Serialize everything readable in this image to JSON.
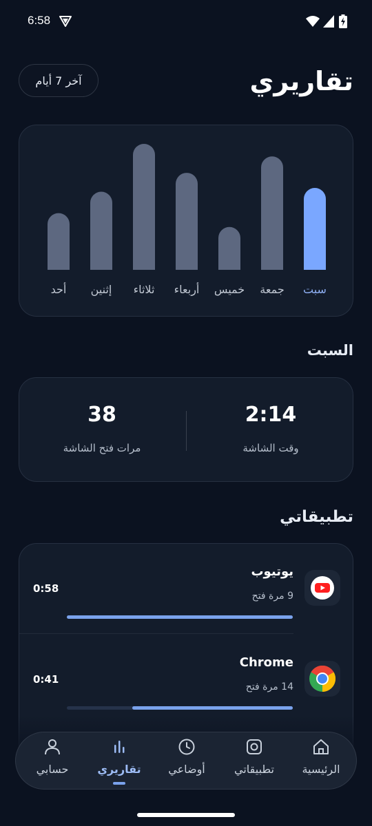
{
  "status_bar": {
    "time": "6:58"
  },
  "header": {
    "title": "تقاريري",
    "range_chip": "آخر 7 أيام"
  },
  "chart_data": {
    "type": "bar",
    "categories": [
      "سبت",
      "جمعة",
      "خميس",
      "أربعاء",
      "ثلاثاء",
      "إثنين",
      "أحد"
    ],
    "values": [
      0.65,
      0.9,
      0.34,
      0.77,
      1.0,
      0.62,
      0.45
    ],
    "selected_index": 0,
    "colors": {
      "bar": "#5d6880",
      "selected_bar": "#7aa7ff",
      "label": "#c0c7d2",
      "selected_label": "#8fb0f5"
    }
  },
  "day_section": {
    "title": "السبت",
    "screen_time_value": "2:14",
    "screen_time_label": "وقت الشاشة",
    "unlocks_value": "38",
    "unlocks_label": "مرات فتح الشاشة"
  },
  "apps_section": {
    "title": "تطبيقاتي",
    "apps": [
      {
        "name": "يوتيوب",
        "opens": "9 مرة فتح",
        "time": "0:58",
        "progress": 1.0,
        "icon": "youtube-icon"
      },
      {
        "name": "Chrome",
        "opens": "14 مرة فتح",
        "time": "0:41",
        "progress": 0.71,
        "icon": "chrome-icon"
      }
    ]
  },
  "bottom_nav": {
    "items": [
      {
        "label": "الرئيسية",
        "icon": "home-icon"
      },
      {
        "label": "تطبيقاتي",
        "icon": "apps-icon"
      },
      {
        "label": "أوضاعي",
        "icon": "clock-icon"
      },
      {
        "label": "تقاريري",
        "icon": "bar-chart-icon",
        "active": true
      },
      {
        "label": "حسابي",
        "icon": "person-icon"
      }
    ]
  }
}
